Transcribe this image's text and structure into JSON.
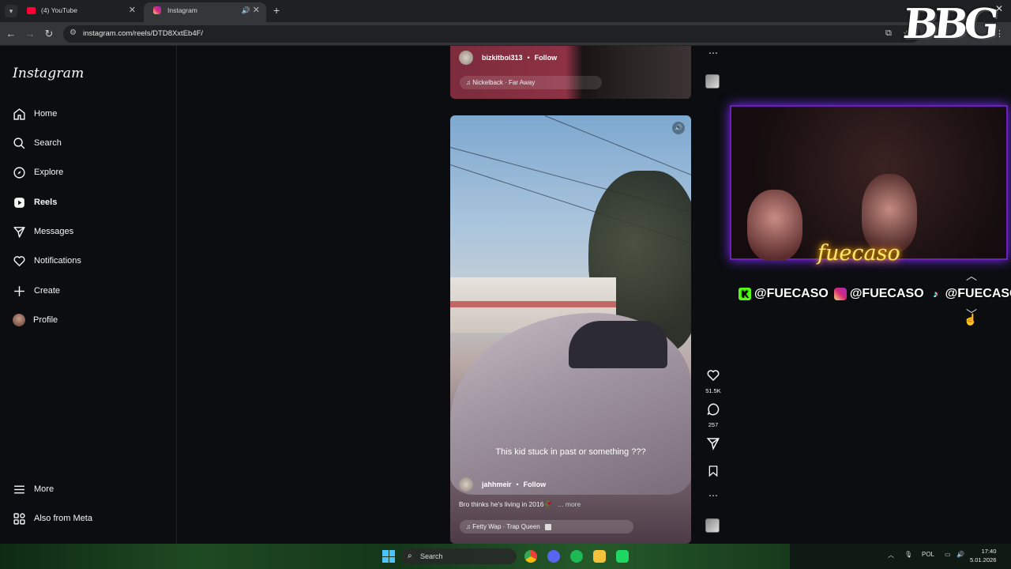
{
  "browser": {
    "tabs": [
      {
        "title": "(4) YouTube"
      },
      {
        "title": "Instagram"
      }
    ],
    "url": "instagram.com/reels/DTD8XxtEb4F/"
  },
  "sidebar": {
    "logo": "Instagram",
    "items": [
      {
        "label": "Home",
        "icon": "home-icon"
      },
      {
        "label": "Search",
        "icon": "search-icon"
      },
      {
        "label": "Explore",
        "icon": "compass-icon"
      },
      {
        "label": "Reels",
        "icon": "reels-icon"
      },
      {
        "label": "Messages",
        "icon": "paper-plane-icon"
      },
      {
        "label": "Notifications",
        "icon": "heart-icon"
      },
      {
        "label": "Create",
        "icon": "plus-icon"
      },
      {
        "label": "Profile",
        "icon": "avatar"
      }
    ],
    "more": "More",
    "also_from_meta": "Also from Meta"
  },
  "reel_prev": {
    "username": "bizkitboi313",
    "follow": "Follow",
    "music": "Nickelback · Far Away"
  },
  "reel_main": {
    "overlay_text": "This kid stuck in past or something ???",
    "username": "jahhmeir",
    "follow": "Follow",
    "caption": "Bro thinks he's living in 2016🥀",
    "more": "... more",
    "music": "Fetty Wap · Trap Queen",
    "likes": "51.5K",
    "comments": "257"
  },
  "stream_overlay": {
    "logo": "BBG",
    "neon_name": "fuecaso",
    "socials": [
      "@FUECASO",
      "@FUECASO",
      "@FUECASOO"
    ]
  },
  "taskbar": {
    "search_placeholder": "Search",
    "lang": "POL",
    "time": "17:40",
    "date": "5.01.2026"
  },
  "colors": {
    "page_bg": "#0b0d10",
    "webcam_border": "#6b1fb8",
    "neon": "#ffe56a"
  }
}
